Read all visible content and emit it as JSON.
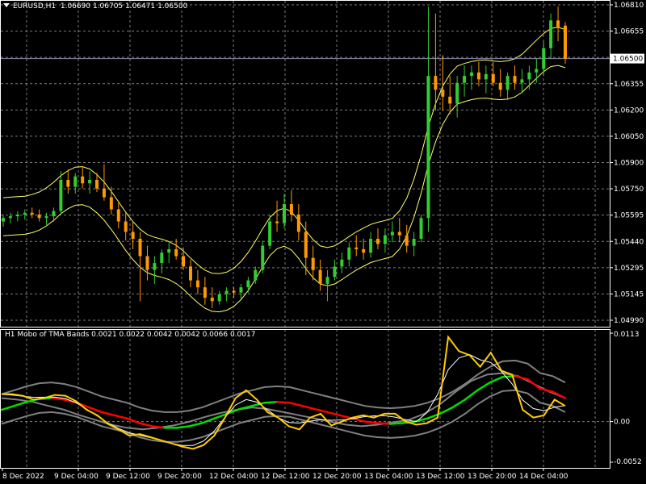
{
  "header": {
    "symbol": "EURUSD,H1",
    "ohlc": "1.06690 1.06705 1.06471 1.06500"
  },
  "indicator": {
    "title": "H1 Mobo of TMA Bands 0.0021 0.0022 0.0042 0.0042 0.0066 0.0017"
  },
  "colors": {
    "bull": "#33cc33",
    "bear": "#ff9900",
    "band": "#ffff66",
    "grid": "#c0c0c0",
    "osc_yellow": "#ffcc00",
    "osc_red": "#ff0000",
    "osc_green": "#00dd00",
    "osc_gray": "#808080",
    "osc_white": "#ffffff"
  },
  "price_axis": {
    "ticks": [
      "1.06810",
      "1.06655",
      "1.06500",
      "1.06355",
      "1.06200",
      "1.06050",
      "1.05900",
      "1.05750",
      "1.05595",
      "1.05440",
      "1.05295",
      "1.05145",
      "1.04990"
    ],
    "current": "1.06500"
  },
  "indicator_axis": {
    "ticks": [
      "0.0113",
      "0.00",
      "-0.0052"
    ]
  },
  "time_axis": {
    "labels": [
      "8 Dec 2022",
      "9 Dec 04:00",
      "9 Dec 12:00",
      "9 Dec 20:00",
      "12 Dec 04:00",
      "12 Dec 12:00",
      "12 Dec 20:00",
      "13 Dec 04:00",
      "13 Dec 12:00",
      "13 Dec 20:00",
      "14 Dec 04:00"
    ]
  },
  "chart_data": [
    {
      "type": "candlestick",
      "ylim": [
        1.0499,
        1.0681
      ],
      "candles": [
        [
          1.0556,
          1.056,
          1.0553,
          1.0558
        ],
        [
          1.0558,
          1.0561,
          1.0555,
          1.0559
        ],
        [
          1.0559,
          1.0562,
          1.0556,
          1.056
        ],
        [
          1.056,
          1.0563,
          1.0557,
          1.0561
        ],
        [
          1.0561,
          1.0564,
          1.0558,
          1.056
        ],
        [
          1.056,
          1.0563,
          1.0556,
          1.0558
        ],
        [
          1.0558,
          1.0561,
          1.0554,
          1.0559
        ],
        [
          1.0559,
          1.0564,
          1.0556,
          1.0562
        ],
        [
          1.0562,
          1.0585,
          1.056,
          1.058
        ],
        [
          1.058,
          1.0586,
          1.0572,
          1.0576
        ],
        [
          1.0576,
          1.0584,
          1.0572,
          1.0582
        ],
        [
          1.0582,
          1.0588,
          1.0575,
          1.0578
        ],
        [
          1.0578,
          1.0585,
          1.0572,
          1.058
        ],
        [
          1.058,
          1.0584,
          1.0573,
          1.0575
        ],
        [
          1.0575,
          1.0589,
          1.0568,
          1.057
        ],
        [
          1.057,
          1.0576,
          1.056,
          1.0563
        ],
        [
          1.0563,
          1.0568,
          1.0552,
          1.0556
        ],
        [
          1.0556,
          1.0562,
          1.0545,
          1.055
        ],
        [
          1.055,
          1.0556,
          1.054,
          1.0546
        ],
        [
          1.0546,
          1.055,
          1.051,
          1.0536
        ],
        [
          1.0536,
          1.0542,
          1.0522,
          1.0528
        ],
        [
          1.0528,
          1.0536,
          1.052,
          1.0532
        ],
        [
          1.0532,
          1.054,
          1.0526,
          1.0538
        ],
        [
          1.0538,
          1.0544,
          1.0532,
          1.054
        ],
        [
          1.054,
          1.0546,
          1.0534,
          1.0536
        ],
        [
          1.0536,
          1.0541,
          1.0528,
          1.053
        ],
        [
          1.053,
          1.0534,
          1.0518,
          1.0522
        ],
        [
          1.0522,
          1.0528,
          1.0514,
          1.0518
        ],
        [
          1.0518,
          1.0524,
          1.0508,
          1.0512
        ],
        [
          1.0512,
          1.0518,
          1.0506,
          1.051
        ],
        [
          1.051,
          1.0516,
          1.0508,
          1.0514
        ],
        [
          1.0514,
          1.0518,
          1.051,
          1.0516
        ],
        [
          1.0516,
          1.0518,
          1.0512,
          1.0515
        ],
        [
          1.0515,
          1.052,
          1.0511,
          1.0518
        ],
        [
          1.0518,
          1.0524,
          1.0515,
          1.0522
        ],
        [
          1.0522,
          1.053,
          1.052,
          1.0528
        ],
        [
          1.0528,
          1.0545,
          1.0526,
          1.0542
        ],
        [
          1.0542,
          1.056,
          1.054,
          1.0556
        ],
        [
          1.0556,
          1.0568,
          1.055,
          1.0555
        ],
        [
          1.0555,
          1.0572,
          1.0552,
          1.0566
        ],
        [
          1.0566,
          1.0574,
          1.0556,
          1.056
        ],
        [
          1.056,
          1.0566,
          1.0545,
          1.055
        ],
        [
          1.055,
          1.0556,
          1.0525,
          1.0535
        ],
        [
          1.0535,
          1.0542,
          1.0522,
          1.0528
        ],
        [
          1.0528,
          1.0534,
          1.0516,
          1.052
        ],
        [
          1.052,
          1.0528,
          1.051,
          1.0524
        ],
        [
          1.0524,
          1.0534,
          1.0522,
          1.053
        ],
        [
          1.053,
          1.0538,
          1.0526,
          1.0534
        ],
        [
          1.0534,
          1.0544,
          1.053,
          1.0541
        ],
        [
          1.0541,
          1.0548,
          1.0536,
          1.054
        ],
        [
          1.054,
          1.0546,
          1.0534,
          1.0538
        ],
        [
          1.0538,
          1.055,
          1.0535,
          1.0546
        ],
        [
          1.0546,
          1.0552,
          1.054,
          1.0543
        ],
        [
          1.0543,
          1.0552,
          1.0538,
          1.0548
        ],
        [
          1.0548,
          1.0556,
          1.0544,
          1.055
        ],
        [
          1.055,
          1.0558,
          1.0544,
          1.0548
        ],
        [
          1.0548,
          1.0554,
          1.0538,
          1.0542
        ],
        [
          1.0542,
          1.055,
          1.0536,
          1.0546
        ],
        [
          1.0546,
          1.056,
          1.0544,
          1.0558
        ],
        [
          1.0558,
          1.068,
          1.055,
          1.064
        ],
        [
          1.064,
          1.0676,
          1.062,
          1.0632
        ],
        [
          1.0632,
          1.0652,
          1.062,
          1.0628
        ],
        [
          1.0628,
          1.064,
          1.0618,
          1.0624
        ],
        [
          1.0624,
          1.064,
          1.0616,
          1.0636
        ],
        [
          1.0636,
          1.0646,
          1.0628,
          1.064
        ],
        [
          1.064,
          1.0646,
          1.0632,
          1.0642
        ],
        [
          1.0642,
          1.0648,
          1.0634,
          1.0638
        ],
        [
          1.0638,
          1.0646,
          1.063,
          1.0641
        ],
        [
          1.0641,
          1.0648,
          1.0634,
          1.0636
        ],
        [
          1.0636,
          1.0644,
          1.0628,
          1.0632
        ],
        [
          1.0632,
          1.0642,
          1.0626,
          1.064
        ],
        [
          1.064,
          1.0646,
          1.0632,
          1.0636
        ],
        [
          1.0636,
          1.0644,
          1.063,
          1.0638
        ],
        [
          1.0638,
          1.0646,
          1.0632,
          1.0642
        ],
        [
          1.0642,
          1.065,
          1.0636,
          1.0644
        ],
        [
          1.0644,
          1.066,
          1.064,
          1.0656
        ],
        [
          1.0656,
          1.0676,
          1.065,
          1.0672
        ],
        [
          1.0672,
          1.068,
          1.066,
          1.0668
        ],
        [
          1.0669,
          1.0671,
          1.0647,
          1.065
        ]
      ]
    },
    {
      "type": "line",
      "ylim": [
        -0.0052,
        0.0113
      ],
      "series": [
        {
          "values": [
            0.0035,
            0.0035,
            0.0033,
            0.0028,
            0.003,
            0.0034,
            0.0033,
            0.0026,
            0.0015,
            0.0008,
            -0.0003,
            -0.001,
            -0.0018,
            -0.0016,
            -0.002,
            -0.0024,
            -0.0028,
            -0.0032,
            -0.0035,
            -0.003,
            -0.0018,
            0.0005,
            0.003,
            0.004,
            0.0028,
            0.0012,
            0.0005,
            -0.0006,
            -0.001,
            0.0005,
            0.001,
            -0.0005,
            0.0,
            0.0005,
            0.0008,
            0.0005,
            0.001,
            0.001,
            0.0,
            -0.0004,
            -0.0002,
            0.0005,
            0.0108,
            0.009,
            0.0085,
            0.007,
            0.0088,
            0.0065,
            0.006,
            0.0015,
            0.0005,
            0.0008,
            0.0028,
            0.002
          ]
        },
        {
          "values": [
            0.003,
            0.0028,
            0.0025,
            0.002,
            0.0015,
            0.0008,
            0.0002,
            -0.0004,
            -0.0008,
            -0.001,
            -0.0008,
            -0.0005,
            0.0,
            0.0006,
            0.0011,
            0.0015,
            0.0018,
            0.0016,
            0.0012,
            0.0008,
            0.0004,
            0.0,
            -0.0004,
            -0.0006,
            -0.0004,
            -0.0001,
            0.0002,
            0.001,
            0.0022,
            0.0038,
            0.0052,
            0.006,
            0.0062,
            0.0058,
            0.0048,
            0.0038,
            0.003
          ]
        },
        {
          "values": [
            0.0015,
            0.002,
            0.0025,
            0.0029,
            0.003,
            0.0028,
            0.0024,
            0.0018,
            0.0012,
            0.0008,
            0.0004,
            -0.0002,
            -0.0006,
            -0.0008,
            -0.0008,
            -0.0006,
            -0.0002,
            0.0004,
            0.001,
            0.0016,
            0.002,
            0.0024,
            0.0025,
            0.0024,
            0.002,
            0.0016,
            0.0012,
            0.0008,
            0.0004,
            0.0,
            -0.0002,
            -0.0003,
            -0.0002,
            0.0,
            0.0004,
            0.001,
            0.0018,
            0.0028,
            0.004,
            0.005,
            0.0057,
            0.0058,
            0.0054,
            0.0042,
            0.0038,
            0.003
          ]
        }
      ]
    }
  ]
}
